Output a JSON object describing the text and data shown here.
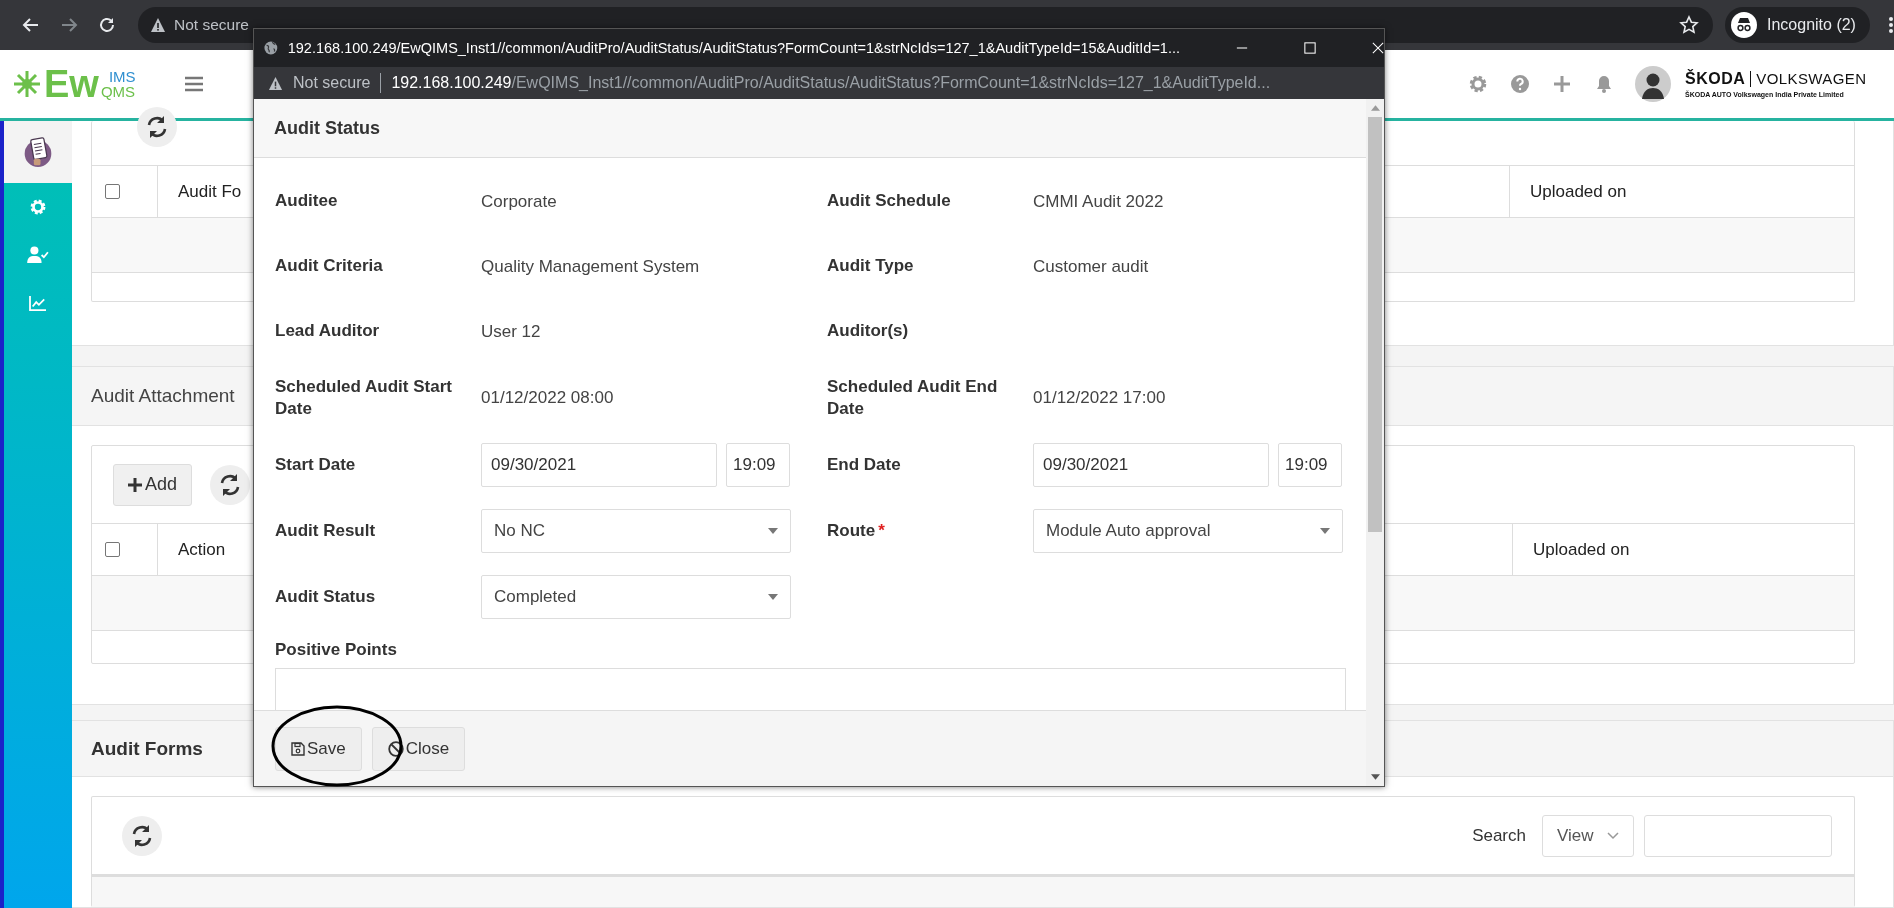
{
  "browser": {
    "security": "Not secure",
    "incognito_label": "Incognito (2)"
  },
  "app_header": {
    "logo": {
      "main": "Ew",
      "top": "IMS",
      "bottom": "QMS"
    },
    "company": {
      "brand_left": "ŠKODA",
      "brand_right": "VOLKSWAGEN",
      "subtitle": "ŠKODA AUTO Volkswagen India Private Limited"
    }
  },
  "sidebar": {
    "items": [
      {
        "kind": "document",
        "selected": true
      },
      {
        "kind": "gear",
        "selected": false
      },
      {
        "kind": "user-check",
        "selected": false
      },
      {
        "kind": "chart",
        "selected": false
      }
    ]
  },
  "forms_table": {
    "columns": [
      "Audit Fo",
      "Uploaded on"
    ],
    "select_all_checked": false
  },
  "attachments": {
    "title": "Audit Attachment",
    "add_button": "Add",
    "columns": [
      "Action",
      "Uploaded on"
    ],
    "select_all_checked": false
  },
  "audit_forms": {
    "title": "Audit Forms",
    "search_label": "Search",
    "view_select": "View"
  },
  "popup": {
    "window_url": "192.168.100.249/EwQIMS_Inst1//common/AuditPro/AuditStatus/AuditStatus?FormCount=1&strNcIds=127_1&AuditTypeId=15&AuditId=1...",
    "security": "Not secure",
    "host": "192.168.100.249",
    "path": "/EwQIMS_Inst1//common/AuditPro/AuditStatus/AuditStatus?FormCount=1&strNcIds=127_1&AuditTypeId...",
    "modal_title": "Audit Status",
    "required_mark": "*",
    "fields": [
      {
        "label": "Auditee",
        "kind": "text",
        "required": false,
        "value": "Corporate"
      },
      {
        "label": "Audit Schedule",
        "kind": "text",
        "required": false,
        "value": "CMMI Audit 2022"
      },
      {
        "label": "Audit Criteria",
        "kind": "text",
        "required": false,
        "value": "Quality Management System"
      },
      {
        "label": "Audit Type",
        "kind": "text",
        "required": false,
        "value": "Customer audit"
      },
      {
        "label": "Lead Auditor",
        "kind": "text",
        "required": false,
        "value": "User 12"
      },
      {
        "label": "Auditor(s)",
        "kind": "text",
        "required": false
      },
      {
        "label": "Scheduled Audit Start Date",
        "kind": "text",
        "required": false,
        "value": "01/12/2022 08:00"
      },
      {
        "label": "Scheduled Audit End Date",
        "kind": "text",
        "required": false,
        "value": "01/12/2022 17:00"
      },
      {
        "label": "Start Date",
        "kind": "datetime",
        "required": false,
        "value": "09/30/2021",
        "time": "19:09"
      },
      {
        "label": "End Date",
        "kind": "datetime",
        "required": false,
        "value": "09/30/2021",
        "time": "19:09"
      },
      {
        "label": "Audit Result",
        "kind": "select",
        "required": false,
        "value": "No NC"
      },
      {
        "label": "Route",
        "kind": "select",
        "required": true,
        "value": "Module Auto approval"
      },
      {
        "label": "Audit Status",
        "kind": "select",
        "required": false,
        "value": "Completed"
      }
    ],
    "positive_points": {
      "label": "Positive Points"
    },
    "buttons": [
      {
        "kind": "save",
        "label": "Save"
      },
      {
        "kind": "close",
        "label": "Close"
      }
    ]
  }
}
